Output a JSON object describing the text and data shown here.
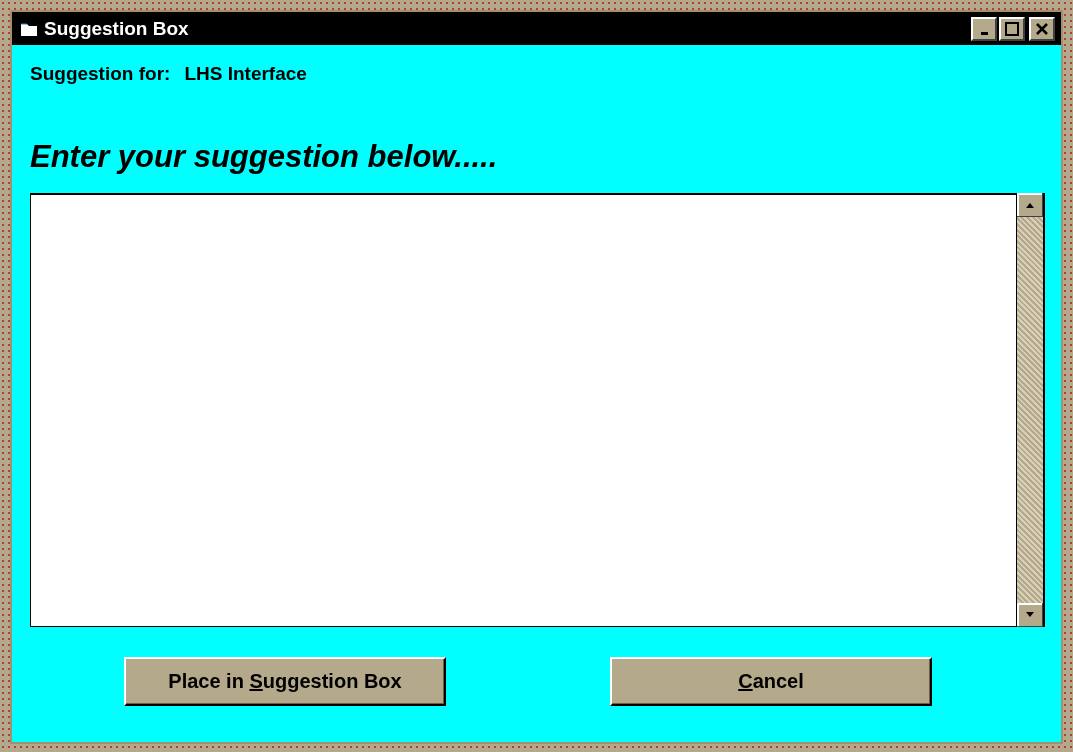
{
  "window": {
    "title": "Suggestion Box"
  },
  "suggestion_for": {
    "label": "Suggestion for:",
    "value": "LHS Interface"
  },
  "heading": "Enter your suggestion below.....",
  "buttons": [
    {
      "before": "Place in ",
      "accel": "S",
      "after": "uggestion Box"
    },
    {
      "accel": "C",
      "after": "ancel"
    }
  ]
}
